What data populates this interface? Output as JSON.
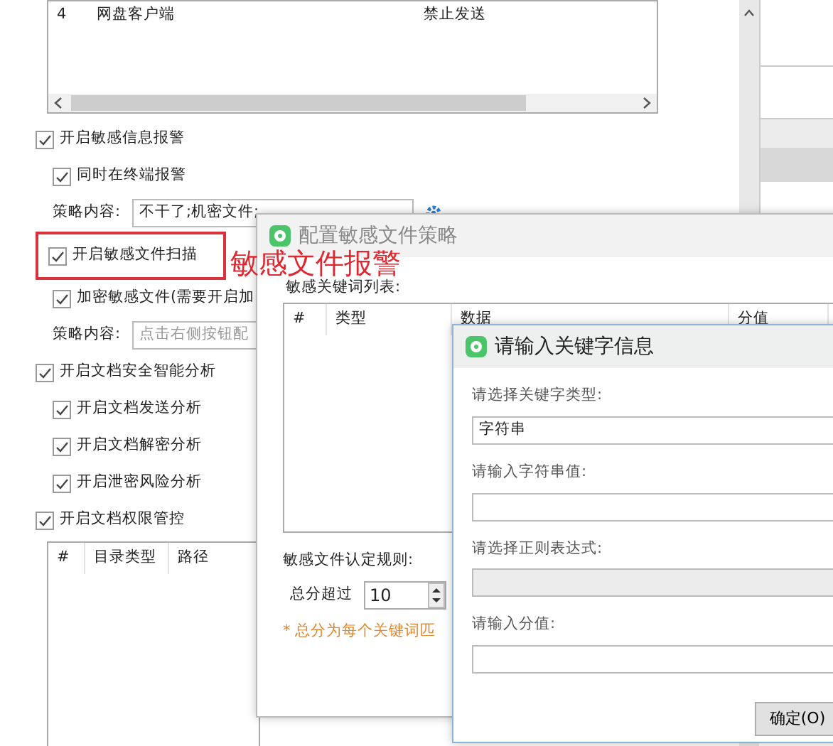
{
  "background_window": {
    "list_rows": [
      {
        "number": "4",
        "name": "网盘客户端",
        "action": "禁止发送"
      }
    ],
    "options": [
      {
        "kind": "checkbox",
        "label": "开启敏感信息报警",
        "checked": true,
        "children": [
          {
            "kind": "checkbox",
            "label": "同时在终端报警",
            "checked": true
          },
          {
            "kind": "policy",
            "label": "策略内容:",
            "value": "不干了;机密文件;",
            "settings_button": true
          }
        ]
      },
      {
        "kind": "checkbox",
        "label": "开启敏感文件扫描",
        "checked": true,
        "highlighted": true,
        "children": [
          {
            "kind": "checkbox",
            "label": "加密敏感文件(需要开启加",
            "checked": true
          },
          {
            "kind": "policy",
            "label": "策略内容:",
            "placeholder": "点击右侧按钮配"
          }
        ]
      },
      {
        "kind": "checkbox",
        "label": "开启文档安全智能分析",
        "checked": true,
        "children": [
          {
            "kind": "checkbox",
            "label": "开启文档发送分析",
            "checked": true
          },
          {
            "kind": "checkbox",
            "label": "开启文档解密分析",
            "checked": true
          },
          {
            "kind": "checkbox",
            "label": "开启泄密风险分析",
            "checked": true
          }
        ]
      },
      {
        "kind": "checkbox",
        "label": "开启文档权限管控",
        "checked": true
      }
    ],
    "directory_table": {
      "columns": [
        "#",
        "目录类型",
        "路径"
      ]
    }
  },
  "annotation": {
    "text": "敏感文件报警"
  },
  "policy_dialog": {
    "title": "配置敏感文件策略",
    "keyword_list_label": "敏感关键词列表:",
    "keyword_table": {
      "columns": [
        "#",
        "类型",
        "数据",
        "分值"
      ]
    },
    "rule_label": "敏感文件认定规则:",
    "score_label": "总分超过",
    "score_value": "10",
    "note": "* 总分为每个关键词匹"
  },
  "keyword_dialog": {
    "title": "请输入关键字信息",
    "fields": [
      {
        "label": "请选择关键字类型:",
        "value": "字符串",
        "disabled": false
      },
      {
        "label": "请输入字符串值:",
        "disabled": false
      },
      {
        "label": "请选择正则表达式:",
        "disabled": true
      },
      {
        "label": "请输入分值:",
        "disabled": false
      }
    ],
    "button": "确定(O)"
  }
}
